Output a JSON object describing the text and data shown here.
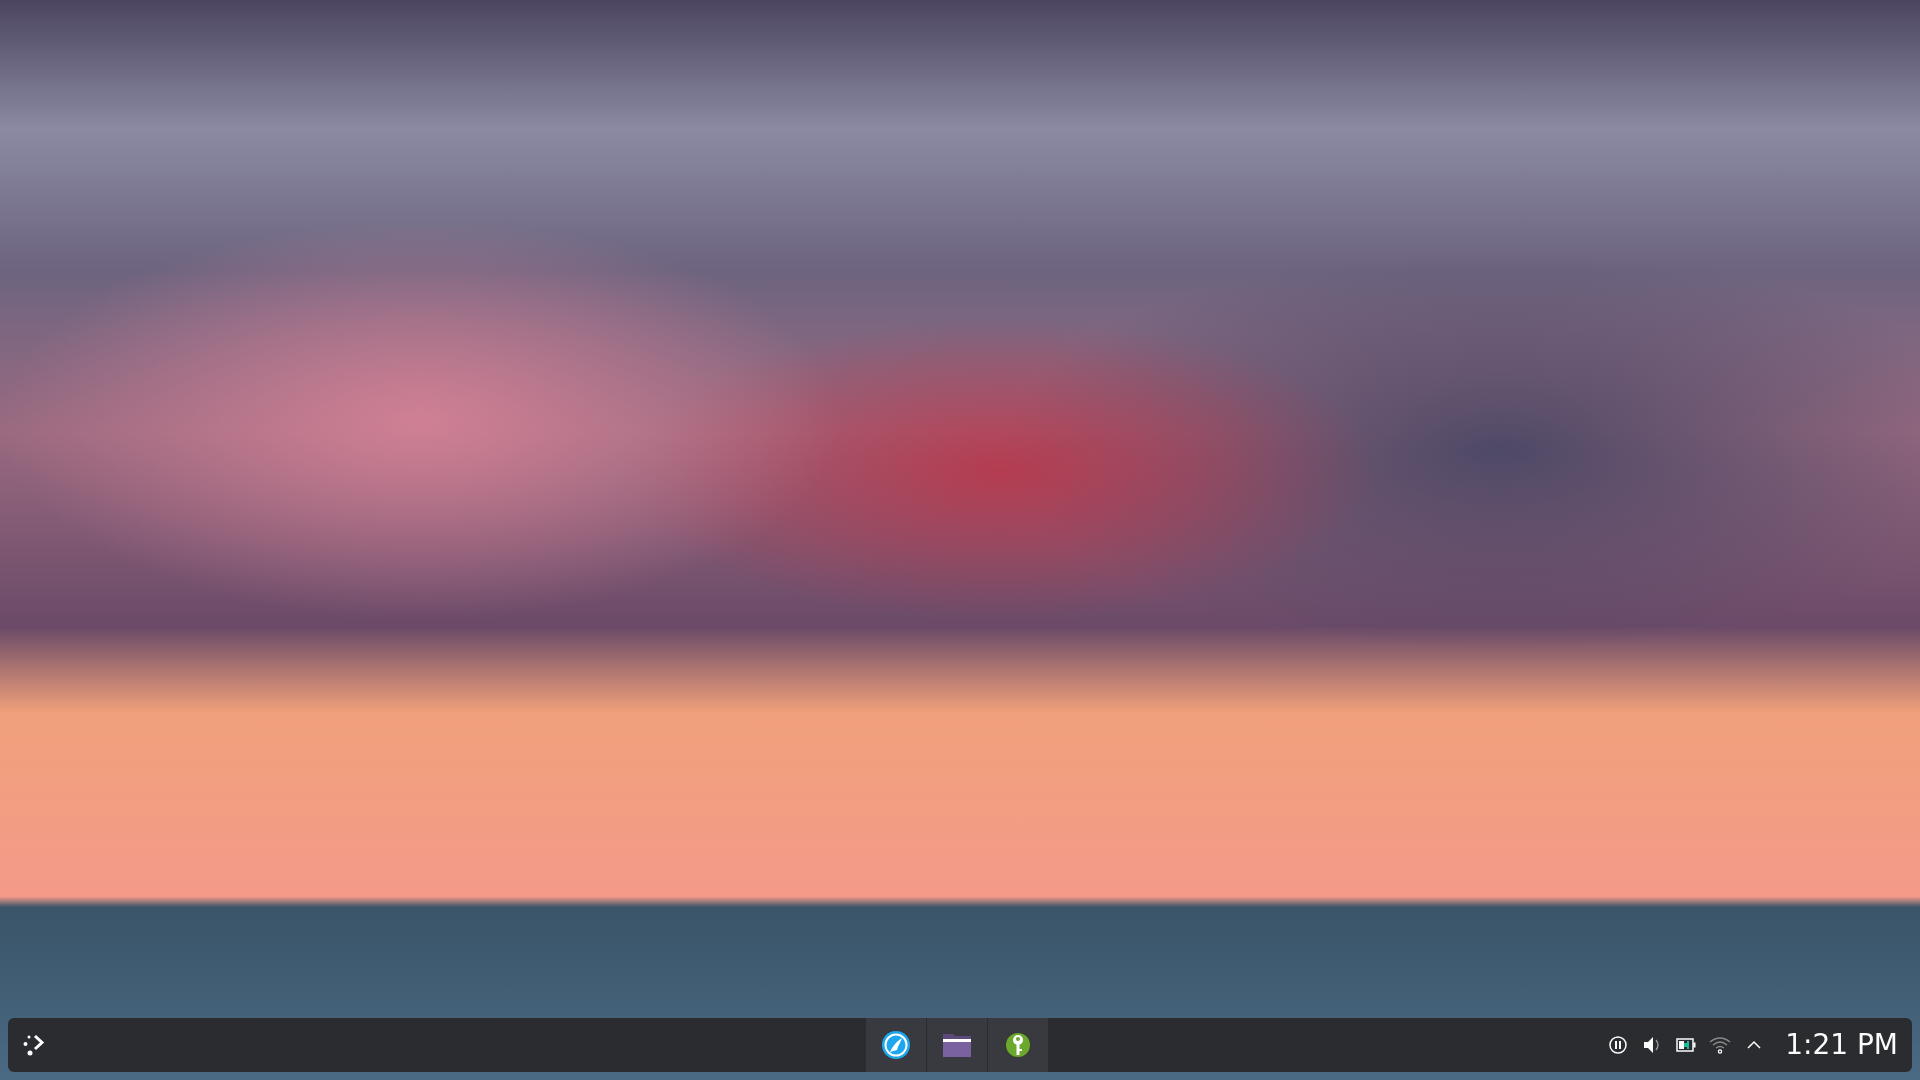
{
  "taskbar": {
    "tasks": [
      {
        "kind": "browser"
      },
      {
        "kind": "folder"
      },
      {
        "kind": "keyring"
      }
    ],
    "tray": [
      {
        "kind": "media"
      },
      {
        "kind": "volume"
      },
      {
        "kind": "battery"
      },
      {
        "kind": "wifi"
      },
      {
        "kind": "expand"
      }
    ],
    "clock": "1:21 PM"
  }
}
